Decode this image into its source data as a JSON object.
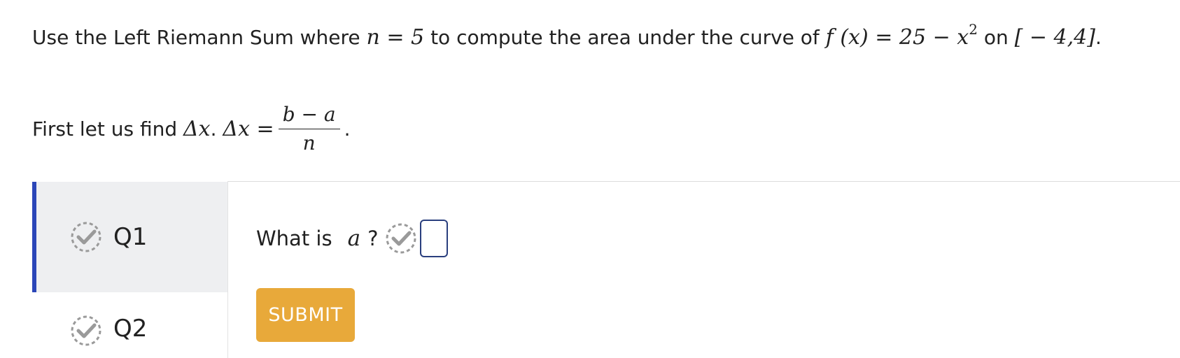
{
  "problem": {
    "prefix": "Use the Left Riemann Sum where",
    "n_expr": "n = 5",
    "mid": "to compute the area under the curve of",
    "f_expr": "f (x) = 25 − x",
    "exponent": "2",
    "on": "on",
    "interval": "[ − 4,4]",
    "end": "."
  },
  "step": {
    "prefix": "First let us find",
    "delta": "Δx",
    "sep": ".",
    "delta_lhs": "Δx =",
    "frac_num": "b − a",
    "frac_den": "n",
    "end": "."
  },
  "questions": [
    {
      "label": "Q1",
      "active": true
    },
    {
      "label": "Q2",
      "active": false
    }
  ],
  "main": {
    "question_prefix": "What is",
    "variable": "a",
    "qmark": "?",
    "answer_value": "",
    "submit_label": "SUBMIT"
  },
  "colors": {
    "accent": "#2b46b8",
    "submit": "#e8a93a",
    "tab_bg": "#eeeff1",
    "input_border": "#2a3f7e"
  }
}
